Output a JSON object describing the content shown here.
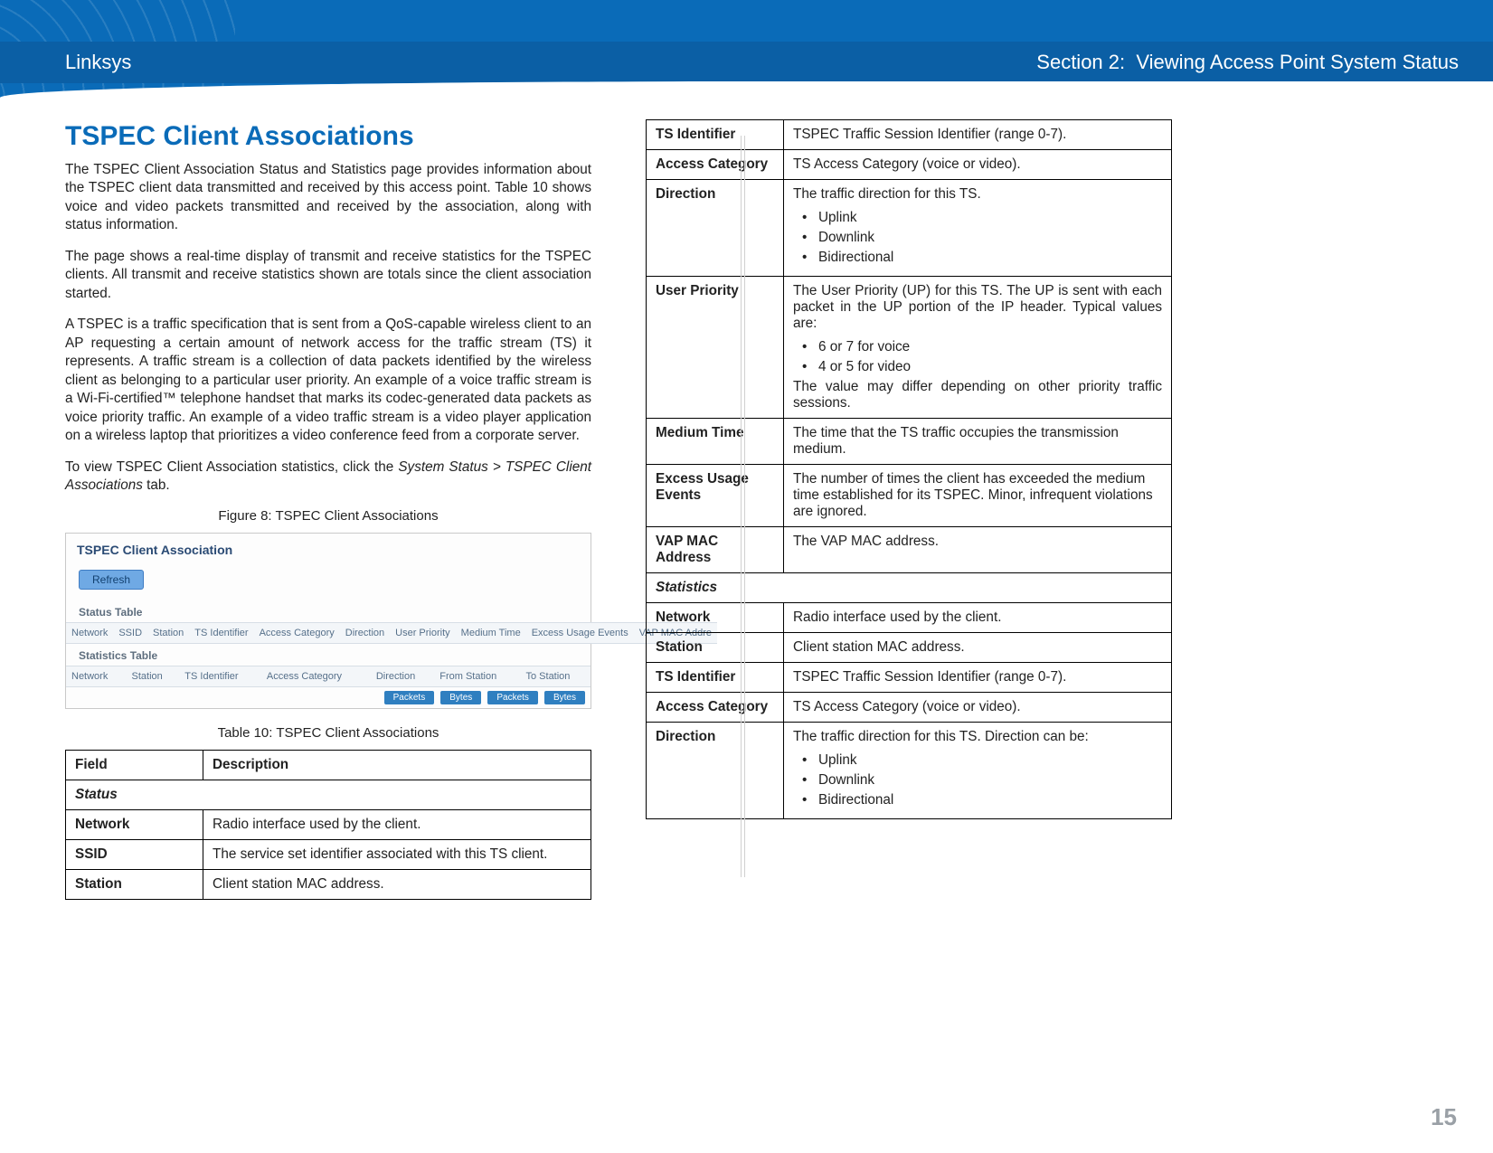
{
  "header": {
    "brand": "Linksys",
    "section_label": "Section 2:  Viewing Access Point System Status"
  },
  "page_number": "15",
  "left": {
    "heading": "TSPEC Client Associations",
    "p1": "The TSPEC Client Association Status and Statistics page provides information about the TSPEC client data transmitted and received by this access point. Table 10 shows voice and video packets transmitted and received by the association, along with status information.",
    "p2": "The page shows a real-time display of transmit and receive statistics for the TSPEC clients. All transmit and receive statistics shown are totals since the client association started.",
    "p3": "A TSPEC is a traffic specification that is sent from a QoS-capable wireless client to an AP requesting a certain amount of network access for the traffic stream (TS) it represents. A traffic stream is a collection of data packets identified by the wireless client as belonging to a particular user priority. An example of a voice traffic stream is a Wi-Fi-certified™ telephone handset that marks its codec-generated data packets as voice priority traffic. An example of a video traffic stream is a video player application on a wireless laptop that prioritizes a video conference feed from a corporate server.",
    "p4_pre": "To view TSPEC Client Association statistics, click the ",
    "p4_ital": "System Status > TSPEC Client Associations",
    "p4_post": " tab.",
    "figure_caption": "Figure 8: TSPEC Client Associations",
    "table_caption": "Table 10: TSPEC Client Associations",
    "fig": {
      "title": "TSPEC Client Association",
      "refresh": "Refresh",
      "status_label": "Status Table",
      "statistics_label": "Statistics Table",
      "status_cols": [
        "Network",
        "SSID",
        "Station",
        "TS Identifier",
        "Access Category",
        "Direction",
        "User Priority",
        "Medium Time",
        "Excess Usage Events",
        "VAP MAC Addre"
      ],
      "stats_cols": [
        "Network",
        "Station",
        "TS Identifier",
        "Access Category",
        "Direction",
        "From Station",
        "To Station"
      ],
      "pills": [
        "Packets",
        "Bytes",
        "Packets",
        "Bytes"
      ]
    },
    "table10": {
      "head_field": "Field",
      "head_desc": "Description",
      "section_status": "Status",
      "rows": [
        {
          "label": "Network",
          "desc": "Radio interface used by the client."
        },
        {
          "label": "SSID",
          "desc": "The service set identifier associated with this TS client."
        },
        {
          "label": "Station",
          "desc": "Client station MAC address."
        }
      ]
    }
  },
  "right": {
    "rows1": [
      {
        "label": "TS Identifier",
        "desc": "TSPEC Traffic Session Identifier (range 0-7)."
      },
      {
        "label": "Access Category",
        "desc": "TS Access Category (voice or video)."
      }
    ],
    "direction": {
      "label": "Direction",
      "intro": "The traffic direction for this TS.",
      "items": [
        "Uplink",
        "Downlink",
        "Bidirectional"
      ]
    },
    "user_priority": {
      "label": "User Priority",
      "intro": "The User Priority (UP) for this TS. The UP is sent with each packet in the UP portion of the IP header. Typical values are:",
      "items": [
        "6 or 7 for voice",
        "4 or 5 for video"
      ],
      "outro": "The value may differ depending on other priority traffic sessions."
    },
    "rows2": [
      {
        "label": "Medium Time",
        "desc": "The time that the TS traffic occupies the transmission medium."
      },
      {
        "label": "Excess Usage Events",
        "desc": "The number of times the client has exceeded the medium time established for its TSPEC. Minor, infrequent violations are ignored."
      },
      {
        "label": "VAP MAC Address",
        "desc": "The VAP MAC address."
      }
    ],
    "section_statistics": "Statistics",
    "rows3": [
      {
        "label": "Network",
        "desc": "Radio interface used by the client."
      },
      {
        "label": "Station",
        "desc": "Client station MAC address."
      },
      {
        "label": "TS Identifier",
        "desc": "TSPEC Traffic Session Identifier (range 0-7)."
      },
      {
        "label": "Access Category",
        "desc": "TS Access Category (voice or video)."
      }
    ],
    "direction2": {
      "label": "Direction",
      "intro": "The traffic direction for this TS. Direction can be:",
      "items": [
        "Uplink",
        "Downlink",
        "Bidirectional"
      ]
    }
  }
}
